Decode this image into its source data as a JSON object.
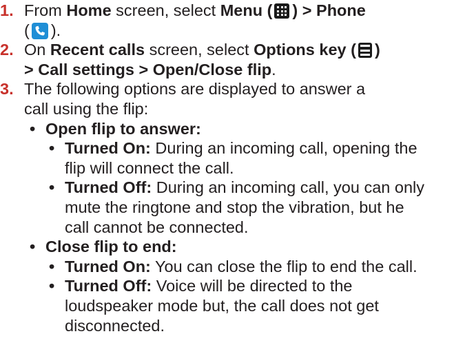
{
  "colors": {
    "number": "#c8312b",
    "text": "#231f20",
    "phone_icon_bg": "#1f8ed6",
    "dark_icon_bg": "#1a1a1a"
  },
  "steps": [
    {
      "num": "1.",
      "t1": "From ",
      "b1": "Home",
      "t2": " screen, select ",
      "b2": "Menu (",
      "icon1": "menu-grid-icon",
      "b3": ") > Phone",
      "t3": "(",
      "icon2": "phone-handset-icon",
      "t4": ")."
    },
    {
      "num": "2.",
      "t1": "On ",
      "b1": "Recent calls",
      "t2": " screen, select ",
      "b2": "Options key (",
      "icon1": "options-list-icon",
      "b3": ")",
      "b4": "> Call settings > Open/Close flip",
      "t3": "."
    },
    {
      "num": "3.",
      "line1": "The following options are displayed to answer a",
      "line2": "call using the flip:"
    }
  ],
  "options": [
    {
      "title": "Open flip to answer:",
      "items": [
        {
          "label": "Turned On:",
          "text": " During an incoming call, opening the",
          "cont": [
            "flip will connect the call."
          ]
        },
        {
          "label": "Turned Off:",
          "text": " During an incoming call, you can only",
          "cont": [
            "mute the ringtone and stop the vibration, but he",
            "call cannot be connected."
          ]
        }
      ]
    },
    {
      "title": "Close flip to end:",
      "items": [
        {
          "label": "Turned On:",
          "text": " You can close the flip to end the call.",
          "cont": []
        },
        {
          "label": "Turned Off:",
          "text": " Voice will be directed to the",
          "cont": [
            "loudspeaker mode but, the call does not get",
            "disconnected."
          ]
        }
      ]
    }
  ]
}
